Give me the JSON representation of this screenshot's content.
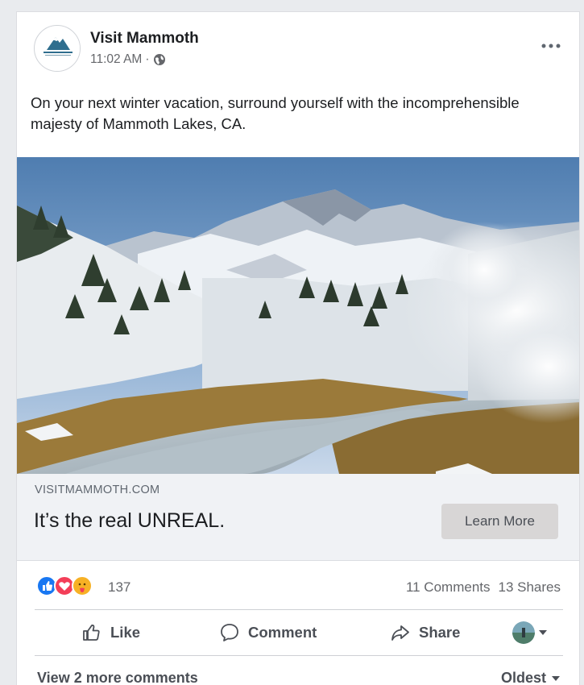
{
  "post": {
    "page_name": "Visit Mammoth",
    "time": "11:02 AM",
    "separator": "·",
    "privacy_icon": "globe-icon",
    "text": "On your next winter vacation, surround yourself with the incomprehensible majesty of Mammoth Lakes, CA."
  },
  "link_preview": {
    "domain": "VISITMAMMOTH.COM",
    "headline": "It’s the real UNREAL.",
    "cta_label": "Learn More"
  },
  "reactions": {
    "types": [
      "like",
      "love",
      "care"
    ],
    "count": "137",
    "comments": "11 Comments",
    "shares": "13 Shares"
  },
  "actions": {
    "like_label": "Like",
    "comment_label": "Comment",
    "share_label": "Share"
  },
  "comments_bar": {
    "view_more": "View 2 more comments",
    "sort_label": "Oldest"
  },
  "colors": {
    "like": "#1877f2",
    "love": "#f33e58",
    "care": "#f7b125",
    "cta_bg": "#d8d6d6",
    "link_bar_bg": "#f0f2f5"
  }
}
